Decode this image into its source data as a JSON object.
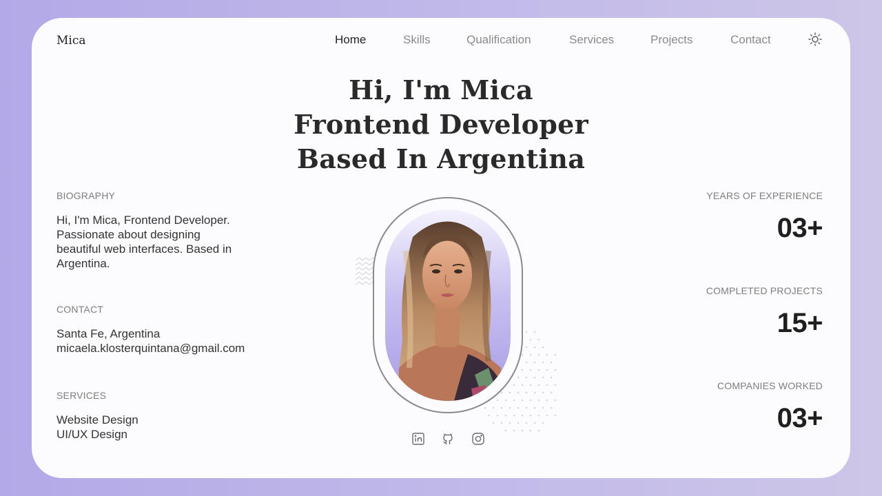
{
  "brand": {
    "logo": "Mica"
  },
  "nav": {
    "items": [
      {
        "label": "Home",
        "active": true
      },
      {
        "label": "Skills",
        "active": false
      },
      {
        "label": "Qualification",
        "active": false
      },
      {
        "label": "Services",
        "active": false
      },
      {
        "label": "Projects",
        "active": false
      },
      {
        "label": "Contact",
        "active": false
      }
    ],
    "theme_icon": "sun-icon"
  },
  "hero": {
    "lines": [
      "Hi, I'm Mica",
      "Frontend Developer",
      "Based In Argentina"
    ]
  },
  "biography": {
    "label": "BIOGRAPHY",
    "lines": [
      "Hi, I'm Mica, Frontend Developer.",
      "Passionate about designing",
      "beautiful web interfaces. Based in",
      "Argentina."
    ]
  },
  "contact": {
    "label": "CONTACT",
    "location": "Santa Fe, Argentina",
    "email": "micaela.klosterquintana@gmail.com"
  },
  "services": {
    "label": "SERVICES",
    "items": [
      "Website Design",
      "UI/UX Design"
    ]
  },
  "stats": [
    {
      "label": "YEARS OF EXPERIENCE",
      "value": "03+"
    },
    {
      "label": "COMPLETED PROJECTS",
      "value": "15+"
    },
    {
      "label": "COMPANIES WORKED",
      "value": "03+"
    }
  ],
  "socials": [
    {
      "icon": "linkedin-icon"
    },
    {
      "icon": "github-icon"
    },
    {
      "icon": "instagram-icon"
    }
  ],
  "colors": {
    "background": "#b3a9e8",
    "card": "#fcfcfe",
    "accent": "#a79be6",
    "text": "#222222",
    "muted": "#8a8a8a"
  }
}
